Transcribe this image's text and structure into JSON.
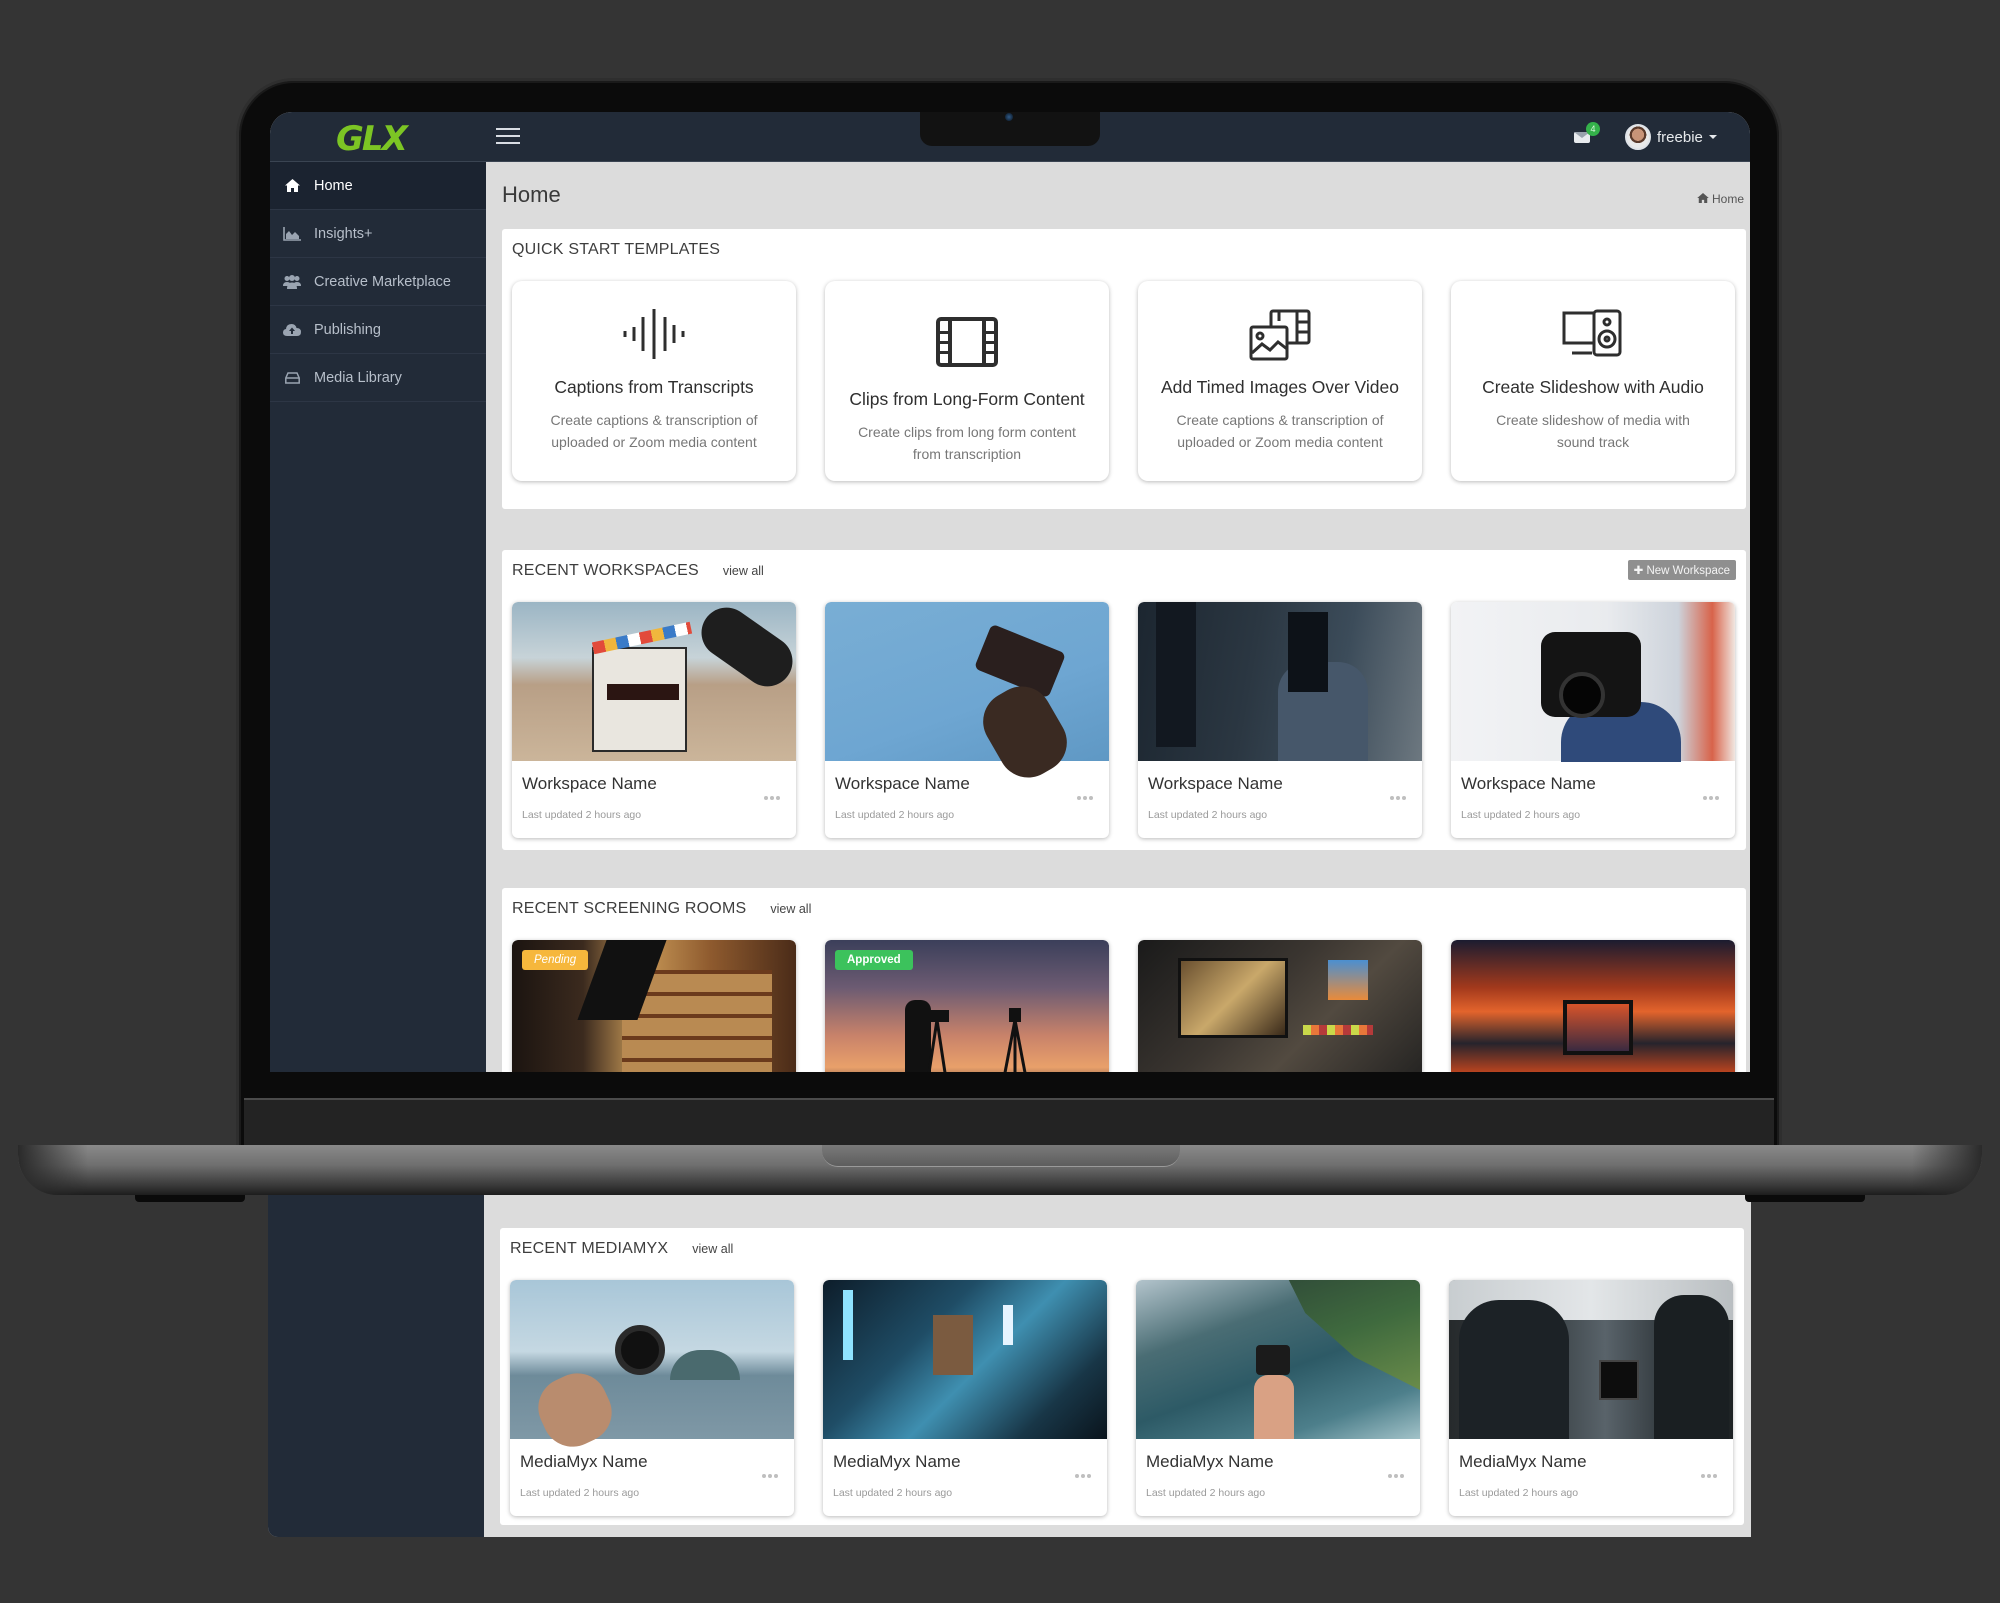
{
  "app": {
    "logo": "GLX",
    "brand_color": "#7cc524",
    "topbar_bg": "#222b38"
  },
  "topbar": {
    "menu_icon": "hamburger-icon",
    "mail_icon": "envelope-icon",
    "mail_badge": "4",
    "user_name": "freebie",
    "user_menu_icon": "caret-down-icon"
  },
  "sidebar": {
    "items": [
      {
        "label": "Home",
        "icon": "home-icon",
        "active": true
      },
      {
        "label": "Insights+",
        "icon": "area-chart-icon",
        "active": false
      },
      {
        "label": "Creative Marketplace",
        "icon": "users-icon",
        "active": false
      },
      {
        "label": "Publishing",
        "icon": "cloud-upload-icon",
        "active": false
      },
      {
        "label": "Media Library",
        "icon": "hdd-icon",
        "active": false
      }
    ]
  },
  "page": {
    "title": "Home",
    "breadcrumb": "Home"
  },
  "quick_start": {
    "title": "QUICK START TEMPLATES",
    "templates": [
      {
        "title": "Captions from Transcripts",
        "description": "Create captions & transcription of uploaded or Zoom media content",
        "icon": "audio-waveform-icon"
      },
      {
        "title": "Clips from Long-Form Content",
        "description": "Create clips from long form content from transcription",
        "icon": "film-icon"
      },
      {
        "title": "Add Timed Images Over Video",
        "description": "Create captions & transcription of uploaded or Zoom media content",
        "icon": "image-over-film-icon"
      },
      {
        "title": "Create Slideshow with Audio",
        "description": "Create slideshow of media with sound track",
        "icon": "monitor-speaker-icon"
      }
    ]
  },
  "workspaces": {
    "title": "RECENT WORKSPACES",
    "view_all": "view all",
    "new_button": "New Workspace",
    "items": [
      {
        "name": "Workspace Name",
        "updated": "Last updated 2 hours ago"
      },
      {
        "name": "Workspace Name",
        "updated": "Last updated 2 hours ago"
      },
      {
        "name": "Workspace Name",
        "updated": "Last updated 2 hours ago"
      },
      {
        "name": "Workspace Name",
        "updated": "Last updated 2 hours ago"
      }
    ]
  },
  "screening_rooms": {
    "title": "RECENT SCREENING ROOMS",
    "view_all": "view all",
    "items": [
      {
        "status": "Pending",
        "status_color": "#f6b73c"
      },
      {
        "status": "Approved",
        "status_color": "#3cc25c"
      },
      {
        "status": null
      },
      {
        "status": null
      }
    ]
  },
  "mediamyx": {
    "title": "RECENT MEDIAMYX",
    "view_all": "view all",
    "items": [
      {
        "name": "MediaMyx Name",
        "updated": "Last updated 2 hours ago"
      },
      {
        "name": "MediaMyx Name",
        "updated": "Last updated 2 hours ago"
      },
      {
        "name": "MediaMyx Name",
        "updated": "Last updated 2 hours ago"
      },
      {
        "name": "MediaMyx Name",
        "updated": "Last updated 2 hours ago"
      }
    ]
  }
}
